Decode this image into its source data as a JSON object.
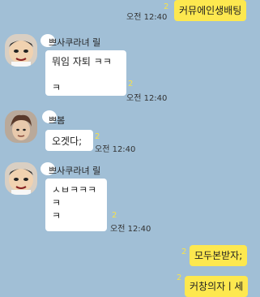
{
  "messages": {
    "m1": {
      "text": "커뮤에인생배팅",
      "read": "2",
      "time": "오전 12:40"
    },
    "m2": {
      "sender": "쁘사쿠라녀 릴",
      "text": "뭐임 자퇴 ㅋㅋ\n\nㅋ",
      "read": "2",
      "time": "오전 12:40"
    },
    "m3": {
      "sender": "쁘봄",
      "text": "오겟다;",
      "read": "2",
      "time": "오전 12:40"
    },
    "m4": {
      "sender": "쁘사쿠라녀 릴",
      "text": "ㅅㅂㅋㅋㅋ\nㅋ\nㅋ",
      "read": "2",
      "time": "오전 12:40"
    },
    "m5": {
      "text": "모두본받자;",
      "read": "2"
    },
    "m6": {
      "text": "커창의자ㅣ세",
      "read": "2"
    }
  },
  "colors": {
    "background": "#a1bfd6",
    "my_bubble": "#fde84f",
    "other_bubble": "#ffffff",
    "unread": "#f7e24a"
  }
}
